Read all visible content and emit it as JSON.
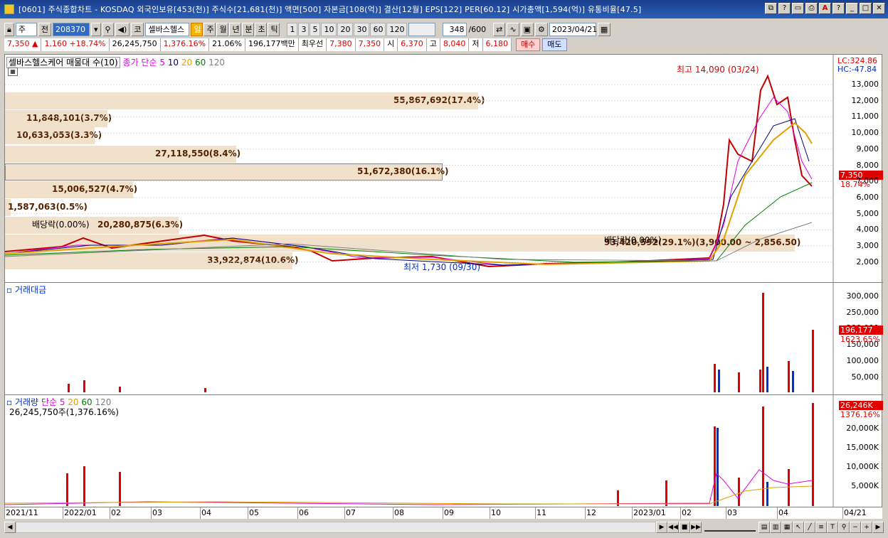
{
  "window": {
    "title": "[0601] 주식종합차트 - KOSDAQ 외국인보유[453(천)] 주식수[21,681(천)] 액면[500] 자본금[108(억)] 결산[12월] EPS[122] PER[60.12] 시가총액[1,594(억)] 유통비율[47.5]"
  },
  "toolbar": {
    "market": "주",
    "prev": "전",
    "code": "208370",
    "sector_tag": "코",
    "stock_name": "셀바스헬스",
    "periods": [
      "일",
      "주",
      "월",
      "년",
      "분",
      "초",
      "틱"
    ],
    "active_period": "일",
    "numbers": [
      "1",
      "3",
      "5",
      "10",
      "20",
      "30",
      "60",
      "120"
    ],
    "count": "348",
    "total": "/600",
    "date": "2023/04/21"
  },
  "quote": {
    "price": "7,350",
    "change": "1,160",
    "change_pct": "+18.74%",
    "volume": "26,245,750",
    "vol_ratio": "1,376.16%",
    "turnover": "21.06%",
    "amount": "196,177백만",
    "pref_label": "최우선",
    "pref_sell": "7,380",
    "pref_buy": "7,350",
    "open_label": "시",
    "open": "6,370",
    "high_label": "고",
    "high": "8,040",
    "low_label": "저",
    "low": "6,180",
    "buy": "매수",
    "sell": "매도"
  },
  "price_pane": {
    "legend_title": "셀바스헬스케어 매물대 수(10)",
    "legend_ma": "종가 단순 5",
    "ma_labels": [
      "10",
      "20",
      "60",
      "120"
    ],
    "ma_colors": [
      "#e000e0",
      "#000080",
      "#e0a000",
      "#008000",
      "#808080"
    ],
    "lc": "LC:324.86",
    "hc": "HC:-47.84",
    "high_note": "최고 14,090 (03/24)",
    "low_note": "최저 1,730 (09/30)",
    "div_note1": "배당락(0.00%)",
    "div_note2": "배당락(0.00%)",
    "current_price": "7,350",
    "current_pct": "18.74%",
    "yaxis": [
      "13,000",
      "12,000",
      "11,000",
      "10,000",
      "9,000",
      "8,000",
      "7,000",
      "6,000",
      "5,000",
      "4,000",
      "3,000",
      "2,000"
    ],
    "volume_profile": [
      {
        "label": "55,867,692(17.4%)"
      },
      {
        "label": "11,848,101(3.7%)"
      },
      {
        "label": "10,633,053(3.3%)"
      },
      {
        "label": "27,118,550(8.4%)"
      },
      {
        "label": "51,672,380(16.1%)"
      },
      {
        "label": "15,006,527(4.7%)"
      },
      {
        "label": "1,587,063(0.5%)"
      },
      {
        "label": "20,280,875(6.3%)"
      },
      {
        "label": "93,420,592(29.1%)(3,900.00 ~ 2,856.50)"
      },
      {
        "label": "33,922,874(10.6%)"
      }
    ]
  },
  "amount_pane": {
    "title": "거래대금",
    "current": "196,177",
    "pct": "1623.65%",
    "yaxis": [
      "300,000",
      "250,000",
      "200,000",
      "150,000",
      "100,000",
      "50,000"
    ]
  },
  "volume_pane": {
    "title": "거래량",
    "ma_label": "단순",
    "ma_values": [
      "5",
      "20",
      "60",
      "120"
    ],
    "subtitle": "26,245,750주(1,376.16%)",
    "current": "26,246K",
    "pct": "1376.16%",
    "yaxis": [
      "20,000K",
      "15,000K",
      "10,000K",
      "5,000K"
    ]
  },
  "time_axis": [
    "2021/11",
    "2022/01",
    "02",
    "03",
    "04",
    "05",
    "06",
    "07",
    "08",
    "09",
    "10",
    "11",
    "12",
    "2023/01",
    "02",
    "03",
    "04",
    "04/21"
  ]
}
